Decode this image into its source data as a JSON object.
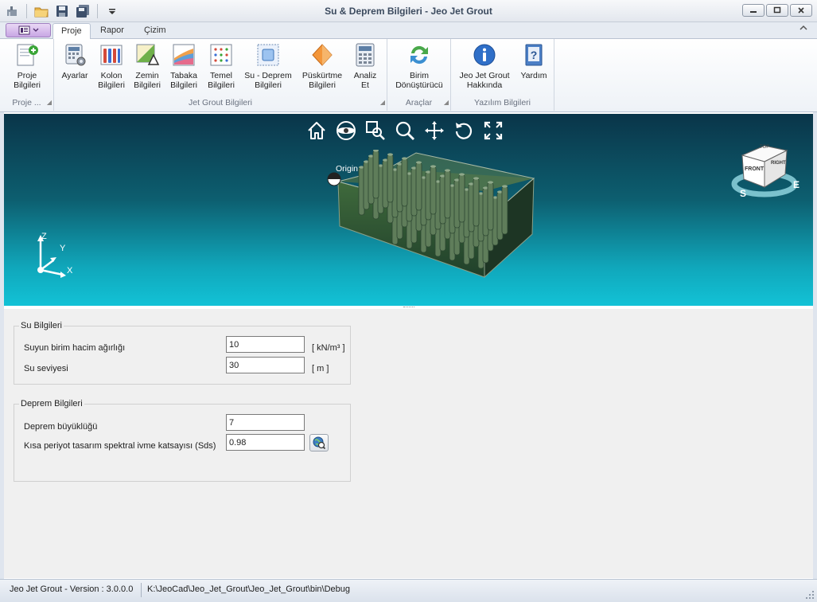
{
  "window": {
    "title": "Su & Deprem Bilgileri - Jeo Jet Grout",
    "minimize": "—",
    "restore": "□",
    "close": "✕"
  },
  "tabs": {
    "proje": "Proje",
    "rapor": "Rapor",
    "cizim": "Çizim",
    "active": "proje"
  },
  "ribbon": {
    "groups": {
      "proje": "Proje ...",
      "jetgrout": "Jet Grout Bilgileri",
      "araclar": "Araçlar",
      "yazilim": "Yazılım Bilgileri"
    },
    "buttons": {
      "proje_bilgileri": [
        "Proje",
        "Bilgileri"
      ],
      "ayarlar": [
        "Ayarlar",
        ""
      ],
      "kolon": [
        "Kolon",
        "Bilgileri"
      ],
      "zemin": [
        "Zemin",
        "Bilgileri"
      ],
      "tabaka": [
        "Tabaka",
        "Bilgileri"
      ],
      "temel": [
        "Temel",
        "Bilgileri"
      ],
      "su_deprem": [
        "Su - Deprem",
        "Bilgileri"
      ],
      "puskurtme": [
        "Püskürtme",
        "Bilgileri"
      ],
      "analiz": [
        "Analiz",
        "Et"
      ],
      "birim": [
        "Birim",
        "Dönüştürücü"
      ],
      "hakkinda": [
        "Jeo Jet Grout",
        "Hakkında"
      ],
      "yardim": [
        "Yardım",
        ""
      ]
    }
  },
  "viewport": {
    "origin_label": "Origin",
    "axis_labels": {
      "z": "Z",
      "y": "Y",
      "x": "X"
    },
    "viewcube": {
      "top": "TOP",
      "front": "FRONT",
      "right": "RIGHT",
      "south": "S",
      "east": "E"
    }
  },
  "su_bilgileri": {
    "legend": "Su Bilgileri",
    "birim_hacim_label": "Suyun birim hacim ağırlığı",
    "birim_hacim_value": "10",
    "birim_hacim_unit": "[ kN/m³ ]",
    "seviye_label": "Su seviyesi",
    "seviye_value": "30",
    "seviye_unit": "[ m ]"
  },
  "deprem_bilgileri": {
    "legend": "Deprem Bilgileri",
    "buyukluk_label": "Deprem büyüklüğü",
    "buyukluk_value": "7",
    "sds_label": "Kısa periyot tasarım spektral ivme katsayısı  (Sds)",
    "sds_value": "0.98"
  },
  "status": {
    "version": "Jeo Jet Grout - Version : 3.0.0.0",
    "path": "K:\\JeoCad\\Jeo_Jet_Grout\\Jeo_Jet_Grout\\bin\\Debug"
  }
}
